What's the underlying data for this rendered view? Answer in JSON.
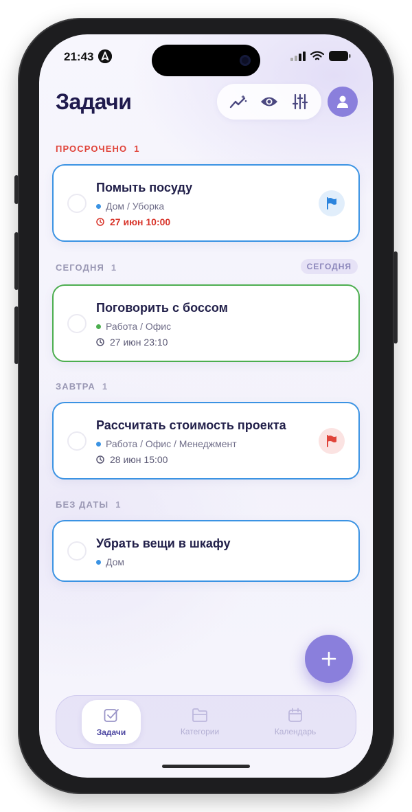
{
  "status_bar": {
    "time": "21:43"
  },
  "header": {
    "title": "Задачи"
  },
  "sections": [
    {
      "title": "ПРОСРОЧЕНО",
      "count": "1"
    },
    {
      "title": "СЕГОДНЯ",
      "count": "1",
      "chip": "СЕГОДНЯ"
    },
    {
      "title": "ЗАВТРА",
      "count": "1"
    },
    {
      "title": "БЕЗ ДАТЫ",
      "count": "1"
    }
  ],
  "tasks": [
    {
      "title": "Помыть посуду",
      "path": "Дом / Уборка",
      "due": "27 июн 10:00",
      "overdue": true,
      "flag": "blue"
    },
    {
      "title": "Поговорить с боссом",
      "path": "Работа / Офис",
      "due": "27 июн 23:10",
      "overdue": false,
      "flag": null
    },
    {
      "title": "Рассчитать стоимость проекта",
      "path": "Работа / Офис / Менеджмент",
      "due": "28 июн 15:00",
      "overdue": false,
      "flag": "red"
    },
    {
      "title": "Убрать вещи в шкафу",
      "path": "Дом",
      "due": "",
      "overdue": false,
      "flag": null
    }
  ],
  "tabs": [
    {
      "label": "Задачи",
      "active": true
    },
    {
      "label": "Категории",
      "active": false
    },
    {
      "label": "Календарь",
      "active": false
    }
  ],
  "colors": {
    "accent": "#8a7fdc",
    "title": "#1f1a4d",
    "overdue": "#e0443a",
    "blue_category": "#3b93e3",
    "green_category": "#4cae4f"
  }
}
